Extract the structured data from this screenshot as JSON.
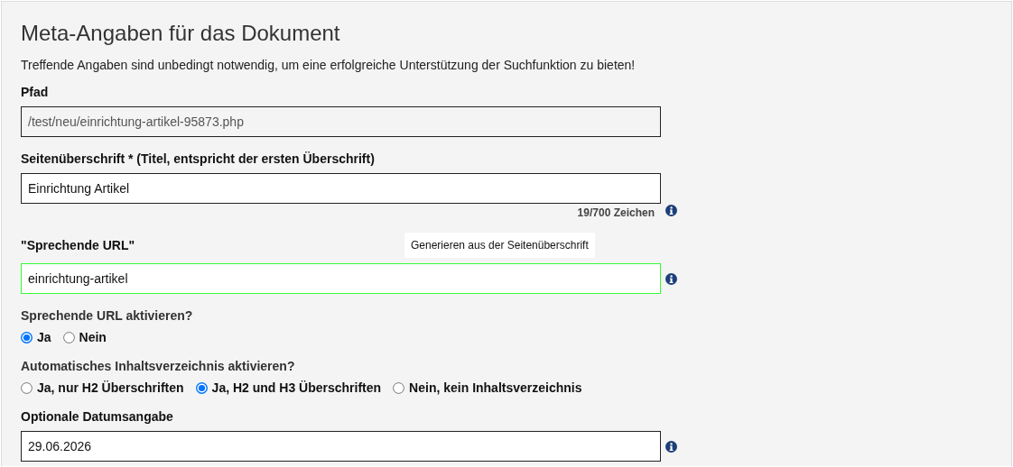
{
  "title": "Meta-Angaben für das Dokument",
  "intro": "Treffende Angaben sind unbedingt notwendig, um eine erfolgreiche Unterstützung der Suchfunktion zu bieten!",
  "sections": [
    {
      "kind": "field",
      "label": "Pfad",
      "value": "/test/neu/einrichtung-artikel-95873.php",
      "readonly": true,
      "valid": false,
      "info": false
    },
    {
      "kind": "field",
      "label": "Seitenüberschrift * (Titel, entspricht der ersten Überschrift)",
      "value": "Einrichtung Artikel",
      "readonly": false,
      "valid": false,
      "counter": "19/700 Zeichen",
      "info": true
    },
    {
      "kind": "field",
      "label": "\"Sprechende URL\"",
      "action": "Generieren aus der Seitenüberschrift",
      "value": "einrichtung-artikel",
      "readonly": false,
      "valid": true,
      "info": true
    },
    {
      "kind": "radio",
      "label": "Sprechende URL aktivieren?",
      "options": [
        {
          "label": "Ja",
          "selected": true
        },
        {
          "label": "Nein",
          "selected": false
        }
      ]
    },
    {
      "kind": "radio",
      "label": "Automatisches Inhaltsverzeichnis aktivieren?",
      "options": [
        {
          "label": "Ja, nur H2 Überschriften",
          "selected": false
        },
        {
          "label": "Ja, H2 und H3 Überschriften",
          "selected": true
        },
        {
          "label": "Nein, kein Inhaltsverzeichnis",
          "selected": false
        }
      ]
    },
    {
      "kind": "field",
      "label": "Optionale Datumsangabe",
      "value": "29.06.2026",
      "readonly": false,
      "valid": false,
      "info": true
    }
  ]
}
